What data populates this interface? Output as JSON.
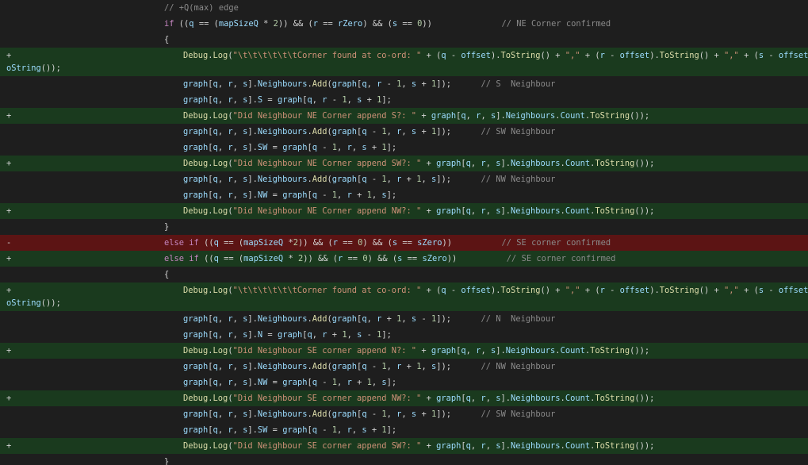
{
  "diff": {
    "lines": [
      {
        "type": "ctx",
        "marker": "",
        "indent": 1,
        "text": "// +Q(max) edge"
      },
      {
        "type": "ctx",
        "marker": "",
        "indent": 1,
        "text": "if ((q == (mapSizeQ * 2)) && (r == rZero) && (s == 0))              // NE Corner confirmed"
      },
      {
        "type": "ctx",
        "marker": "",
        "indent": 1,
        "text": "{"
      },
      {
        "type": "add",
        "marker": "+",
        "indent": 2,
        "text": "Debug.Log(\"\\t\\t\\t\\t\\t\\tCorner found at co-ord: \" + (q - offset).ToString() + \",\" + (r - offset).ToString() + \",\" + (s - offset).T",
        "cont": "oString());"
      },
      {
        "type": "ctx",
        "marker": "",
        "indent": 2,
        "text": "graph[q, r, s].Neighbours.Add(graph[q, r - 1, s + 1]);      // S  Neighbour"
      },
      {
        "type": "ctx",
        "marker": "",
        "indent": 2,
        "text": "graph[q, r, s].S = graph[q, r - 1, s + 1];"
      },
      {
        "type": "add",
        "marker": "+",
        "indent": 2,
        "text": "Debug.Log(\"Did Neighbour NE Corner append S?: \" + graph[q, r, s].Neighbours.Count.ToString());"
      },
      {
        "type": "ctx",
        "marker": "",
        "indent": 2,
        "text": "graph[q, r, s].Neighbours.Add(graph[q - 1, r, s + 1]);      // SW Neighbour"
      },
      {
        "type": "ctx",
        "marker": "",
        "indent": 2,
        "text": "graph[q, r, s].SW = graph[q - 1, r, s + 1];"
      },
      {
        "type": "add",
        "marker": "+",
        "indent": 2,
        "text": "Debug.Log(\"Did Neighbour NE Corner append SW?: \" + graph[q, r, s].Neighbours.Count.ToString());"
      },
      {
        "type": "ctx",
        "marker": "",
        "indent": 2,
        "text": "graph[q, r, s].Neighbours.Add(graph[q - 1, r + 1, s]);      // NW Neighbour"
      },
      {
        "type": "ctx",
        "marker": "",
        "indent": 2,
        "text": "graph[q, r, s].NW = graph[q - 1, r + 1, s];"
      },
      {
        "type": "add",
        "marker": "+",
        "indent": 2,
        "text": "Debug.Log(\"Did Neighbour NE Corner append NW?: \" + graph[q, r, s].Neighbours.Count.ToString());"
      },
      {
        "type": "ctx",
        "marker": "",
        "indent": 1,
        "text": "}"
      },
      {
        "type": "del",
        "marker": "-",
        "indent": 1,
        "text": "else if ((q == (mapSizeQ *2)) && (r == 0) && (s == sZero))          // SE corner confirmed"
      },
      {
        "type": "add",
        "marker": "+",
        "indent": 1,
        "text": "else if ((q == (mapSizeQ * 2)) && (r == 0) && (s == sZero))          // SE corner confirmed"
      },
      {
        "type": "ctx",
        "marker": "",
        "indent": 1,
        "text": "{"
      },
      {
        "type": "add",
        "marker": "+",
        "indent": 2,
        "text": "Debug.Log(\"\\t\\t\\t\\t\\t\\tCorner found at co-ord: \" + (q - offset).ToString() + \",\" + (r - offset).ToString() + \",\" + (s - offset).T",
        "cont": "oString());"
      },
      {
        "type": "ctx",
        "marker": "",
        "indent": 2,
        "text": "graph[q, r, s].Neighbours.Add(graph[q, r + 1, s - 1]);      // N  Neighbour"
      },
      {
        "type": "ctx",
        "marker": "",
        "indent": 2,
        "text": "graph[q, r, s].N = graph[q, r + 1, s - 1];"
      },
      {
        "type": "add",
        "marker": "+",
        "indent": 2,
        "text": "Debug.Log(\"Did Neighbour SE corner append N?: \" + graph[q, r, s].Neighbours.Count.ToString());"
      },
      {
        "type": "ctx",
        "marker": "",
        "indent": 2,
        "text": "graph[q, r, s].Neighbours.Add(graph[q - 1, r + 1, s]);      // NW Neighbour"
      },
      {
        "type": "ctx",
        "marker": "",
        "indent": 2,
        "text": "graph[q, r, s].NW = graph[q - 1, r + 1, s];"
      },
      {
        "type": "add",
        "marker": "+",
        "indent": 2,
        "text": "Debug.Log(\"Did Neighbour SE corner append NW?: \" + graph[q, r, s].Neighbours.Count.ToString());"
      },
      {
        "type": "ctx",
        "marker": "",
        "indent": 2,
        "text": "graph[q, r, s].Neighbours.Add(graph[q - 1, r, s + 1]);      // SW Neighbour"
      },
      {
        "type": "ctx",
        "marker": "",
        "indent": 2,
        "text": "graph[q, r, s].SW = graph[q - 1, r, s + 1];"
      },
      {
        "type": "add",
        "marker": "+",
        "indent": 2,
        "text": "Debug.Log(\"Did Neighbour SE corner append SW?: \" + graph[q, r, s].Neighbours.Count.ToString());"
      },
      {
        "type": "ctx",
        "marker": "",
        "indent": 1,
        "text": "}"
      }
    ]
  },
  "colors": {
    "background": "#1e1e1e",
    "added_line": "#1a3a1e",
    "removed_line": "#5c1414",
    "keyword": "#c586c0",
    "number": "#b5cea8",
    "string": "#ce9178",
    "comment": "#8a8a8a",
    "function": "#dcdcaa",
    "variable": "#9cdcfe"
  }
}
